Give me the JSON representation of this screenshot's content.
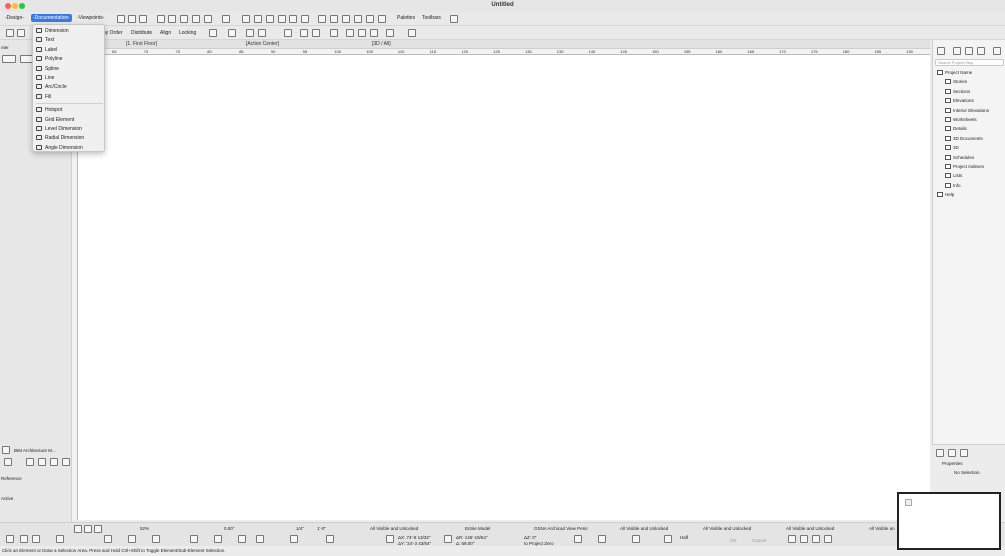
{
  "window": {
    "title": "Untitled"
  },
  "menubar": {
    "design": "-Design-",
    "documentation": "-Documentation-",
    "viewpoints": "-Viewpoints-",
    "palettes": "Palettes",
    "toolbars": "Toolbars"
  },
  "toolbar2": {
    "display_order": "ay Order",
    "distribute": "Distribute",
    "align": "Align",
    "locking": "Locking"
  },
  "tabs": {
    "floor": "[1. First Floor]",
    "action_center": "[Action Center]",
    "threed": "[3D / All]"
  },
  "ruler_ticks": [
    "65",
    "70",
    "75",
    "80",
    "85",
    "90",
    "95",
    "100",
    "105",
    "110",
    "115",
    "120",
    "125",
    "130",
    "135",
    "140",
    "145",
    "150",
    "155",
    "160",
    "165",
    "170",
    "175",
    "180",
    "185",
    "190"
  ],
  "documentation_menu": {
    "items": [
      {
        "label": "Dimension",
        "icon": "dimension-icon"
      },
      {
        "label": "Text",
        "icon": "text-icon"
      },
      {
        "label": "Label",
        "icon": "label-icon"
      },
      {
        "label": "Polyline",
        "icon": "polyline-icon"
      },
      {
        "label": "Spline",
        "icon": "spline-icon"
      },
      {
        "label": "Line",
        "icon": "line-icon"
      },
      {
        "label": "Arc/Circle",
        "icon": "arc-circle-icon"
      },
      {
        "label": "Fill",
        "icon": "fill-icon"
      },
      {
        "label": "Hotspot",
        "icon": "hotspot-icon"
      },
      {
        "label": "Grid Element",
        "icon": "grid-element-icon"
      },
      {
        "label": "Level Dimension",
        "icon": "level-dimension-icon"
      },
      {
        "label": "Radial Dimension",
        "icon": "radial-dimension-icon"
      },
      {
        "label": "Angle Dimension",
        "icon": "angle-dimension-icon"
      }
    ]
  },
  "navigator": {
    "search_placeholder": "Search Project Map",
    "items": [
      {
        "label": "Project Name",
        "level": 0
      },
      {
        "label": "Stories",
        "level": 1
      },
      {
        "label": "Sections",
        "level": 1
      },
      {
        "label": "Elevations",
        "level": 1
      },
      {
        "label": "Interior Elevations",
        "level": 1
      },
      {
        "label": "Worksheets",
        "level": 1
      },
      {
        "label": "Details",
        "level": 1
      },
      {
        "label": "3D Documents",
        "level": 1
      },
      {
        "label": "3D",
        "level": 1
      },
      {
        "label": "Schedules",
        "level": 1
      },
      {
        "label": "Project Indexes",
        "level": 1
      },
      {
        "label": "Lists",
        "level": 1
      },
      {
        "label": "Info",
        "level": 1
      },
      {
        "label": "Help",
        "level": 0
      }
    ]
  },
  "properties": {
    "title": "Properties",
    "value": "No Selection."
  },
  "left_panel": {
    "header": "nter",
    "template": "BIM Architecture M...",
    "reference": "Reference",
    "active": "Active"
  },
  "statusbar": {
    "zoom": "52%",
    "angle": "0.00°",
    "scale": "1/4\"",
    "dim": "1'-0\"",
    "layer1": "All Visible and Unlocked",
    "model": "Entire Model",
    "pens": "GSNA Archicad View Pens",
    "layer2": "All Visible and Unlocked",
    "layer3": "All Visible and Unlocked",
    "layer4": "All Visible and Unlocked",
    "layer5": "All Visible an",
    "ax": "ΔX: 74'-8 13/32\"",
    "ay": "ΔY: '24'-3 43/64\"",
    "ar": "ΔR: 145'-19/64\"",
    "aa": "Δ: 59.00°",
    "az": "ΔZ: 0\"",
    "to_project_zero": "to Project Zero",
    "half": "Half",
    "ok": "OK",
    "cancel": "Cancel"
  },
  "hint": "Click an Element or Draw a Selection Area. Press and Hold Ctrl+Shift to Toggle Element/Sub-Element Selection."
}
